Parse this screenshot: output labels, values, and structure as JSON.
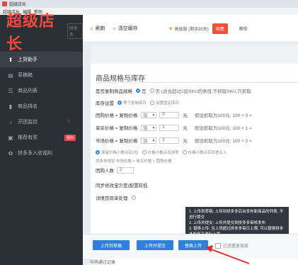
{
  "window": {
    "title": "超级店长"
  },
  "menubar": [
    "超级店长",
    "编辑",
    "帮助"
  ],
  "brand": {
    "name": "超级店长",
    "sub": "拼多多"
  },
  "sidebar": {
    "items": [
      {
        "label": "上货助手",
        "icon": "upload-icon"
      },
      {
        "label": "草稿箱",
        "icon": "inbox-icon"
      },
      {
        "label": "商品列表",
        "icon": "list-icon"
      },
      {
        "label": "商品排名",
        "icon": "bar-chart-icon"
      },
      {
        "label": "开团监控",
        "icon": "bell-icon",
        "badge": "0"
      },
      {
        "label": "推荐有奖",
        "icon": "gift-icon",
        "tag": "福利"
      },
      {
        "label": "拼多多入驻福利",
        "icon": "gift-icon"
      }
    ]
  },
  "toolbar": {
    "refresh_label": "刷新",
    "clear_cache_label": "清空缓存",
    "notice_text": "高级版 (剩余90天)",
    "renew_label": "续费",
    "help_label": "帮你"
  },
  "form": {
    "section_title": "商品规格与库存",
    "copy_spec": {
      "label": "是否复制商品规格",
      "yes": "是",
      "no": "否 (适合超过2层SKU的类目,不抓取SKU,只抓取"
    },
    "stock": {
      "label": "库存设置",
      "opt1": "等于复制库存",
      "opt2": "设置固定库存"
    },
    "group_price": {
      "label": "团购价格 = 复制价格",
      "op": "加",
      "value": "0",
      "unit": "元",
      "hint": "假设抓取为100元: 100 + 0 ="
    },
    "single_price": {
      "label": "单买价格 = 复制价格",
      "op": "加",
      "value": "1",
      "unit": "元",
      "hint": "假设抓取为100元: 100 + 1 ="
    },
    "market_price": {
      "label": "市场价格 = 复制价格",
      "op": "加",
      "value": "2",
      "unit": "元",
      "hint": "假设抓取为100元: 100 + 2 ="
    },
    "rounding": {
      "opt1": "保留价格小数点后2位",
      "opt2": "价格小数点后抹零",
      "opt3": "价格小数点后四舍五入"
    },
    "price_rule_note": "拼多多规定:市场价格 > 单买价格 > 团购价格",
    "group_size": {
      "label": "团购人数",
      "value": "2"
    },
    "sync_label": "同步修改宝贝是(配置较低",
    "detail_label": "详情页简单处理"
  },
  "tooltip": {
    "line1": "1. 上传到草稿: 上传到拼多多后台发布新商品的列表, 不进行提交",
    "line2": "2. 上传并提交: 上传并提交到拼多多审核发布",
    "line3": "3. 替换上传: 当上货超过拼多多每日上限, 可以替换拼多多的商品进行上货。"
  },
  "actions": {
    "draft_label": "上传到草稿",
    "submit_label": "上传并提交",
    "replace_label": "替换上传",
    "filter_label": "过滤重复链接"
  },
  "log_label": "导购通过记录",
  "colors": {
    "accent": "#2d7fe0",
    "brand": "#f04a3e",
    "sidebar": "#2b2f36",
    "arrow": "#e02a2a"
  }
}
